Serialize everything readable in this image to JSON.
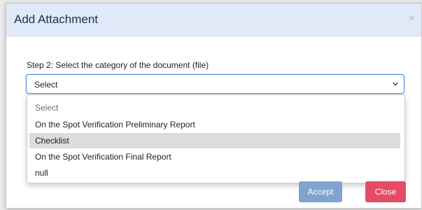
{
  "dialog": {
    "title": "Add Attachment",
    "close_glyph": "×"
  },
  "step": {
    "label": "Step 2: Select the category of the document (file)"
  },
  "category_select": {
    "value": "Select",
    "options": [
      "Select",
      "On the Spot Verification Preliminary Report",
      "Checklist",
      "On the Spot Verification Final Report",
      "null"
    ],
    "highlighted_option": "Checklist"
  },
  "buttons": {
    "accept": "Accept",
    "close": "Close"
  },
  "colors": {
    "header_bg": "#dfe9f7",
    "select_focus_border": "#5b8fd4",
    "accept_bg": "#7fa4cd",
    "close_bg": "#e44b66",
    "highlight_bg": "#dcdcdc"
  },
  "icons": {
    "dialog_close": "close-icon",
    "select_caret": "chevron-down-icon"
  }
}
